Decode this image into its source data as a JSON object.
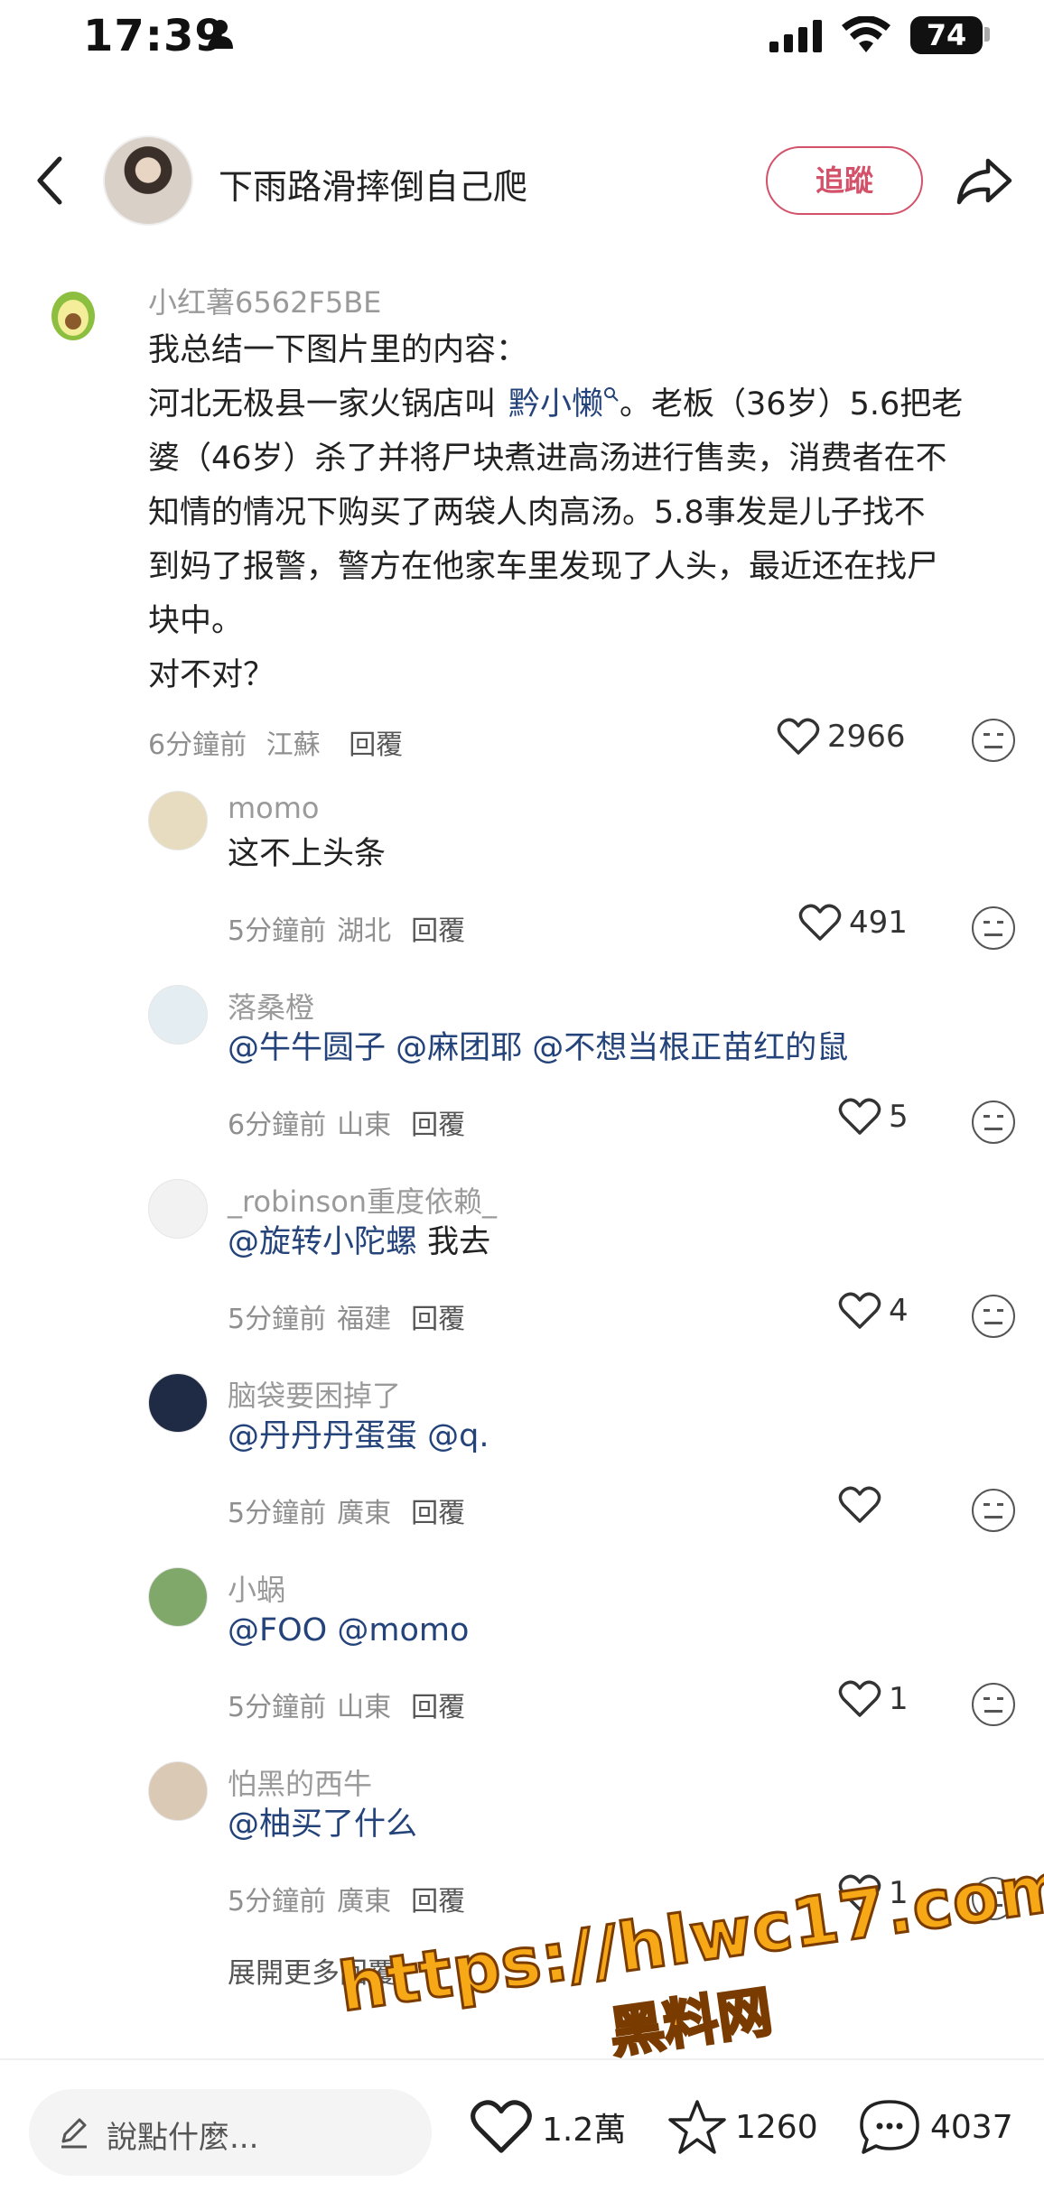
{
  "status_bar": {
    "time": "17:39",
    "battery": "74"
  },
  "header": {
    "title": "下雨路滑摔倒自己爬",
    "follow_label": "追蹤"
  },
  "main_comment": {
    "user": "小红薯6562F5BE",
    "lines": [
      "我总结一下图片里的内容：",
      "河北无极县一家火锅店叫",
      "黔小懒",
      "。老板（36岁）5.6把老",
      "婆（46岁）杀了并将尸块煮进高汤进行售卖，消费者在不",
      "知情的情况下购买了两袋人肉高汤。5.8事发是儿子找不",
      "到妈了报警，警方在他家车里发现了人头，最近还在找尸",
      "块中。",
      "对不对？"
    ],
    "time": "6分鐘前",
    "location": "江蘇",
    "reply_label": "回覆",
    "likes": "2966"
  },
  "replies": [
    {
      "user": "momo",
      "text_parts": [
        {
          "t": "这不上头条",
          "tag": false
        }
      ],
      "time": "5分鐘前",
      "location": "湖北",
      "reply_label": "回覆",
      "likes": "491",
      "avatar_color": "#e8dcc0"
    },
    {
      "user": "落桑橙",
      "text_parts": [
        {
          "t": "@牛牛圆子 @麻团耶 @不想当根正苗红的鼠",
          "tag": true
        }
      ],
      "time": "6分鐘前",
      "location": "山東",
      "reply_label": "回覆",
      "likes": "5",
      "avatar_color": "#e4eef2"
    },
    {
      "user": "_robinson重度依赖_",
      "text_parts": [
        {
          "t": "@旋转小陀螺",
          "tag": true
        },
        {
          "t": " 我去",
          "tag": false
        }
      ],
      "time": "5分鐘前",
      "location": "福建",
      "reply_label": "回覆",
      "likes": "4",
      "avatar_color": "#f2f2f2"
    },
    {
      "user": "脑袋要困掉了",
      "text_parts": [
        {
          "t": "@丹丹丹蛋蛋 @q.",
          "tag": true
        }
      ],
      "time": "5分鐘前",
      "location": "廣東",
      "reply_label": "回覆",
      "likes": "",
      "avatar_color": "#1f2a44"
    },
    {
      "user": "小蜗",
      "text_parts": [
        {
          "t": "@FOO @momo",
          "tag": true
        }
      ],
      "time": "5分鐘前",
      "location": "山東",
      "reply_label": "回覆",
      "likes": "1",
      "avatar_color": "#7fa86a"
    },
    {
      "user": "怕黑的西牛",
      "text_parts": [
        {
          "t": "@柚买了什么",
          "tag": true
        }
      ],
      "time": "5分鐘前",
      "location": "廣東",
      "reply_label": "回覆",
      "likes": "1",
      "avatar_color": "#d9c9b5"
    }
  ],
  "more_replies_label": "展開更多回覆",
  "bottom_bar": {
    "input_placeholder": "說點什麼...",
    "likes": "1.2萬",
    "stars": "1260",
    "comments": "4037"
  },
  "watermark": {
    "url": "https://hlwc17.com",
    "name": "黑料网"
  },
  "colors": {
    "accent": "#d3526a",
    "tag": "#23437a",
    "watermark": "#f6a817"
  }
}
